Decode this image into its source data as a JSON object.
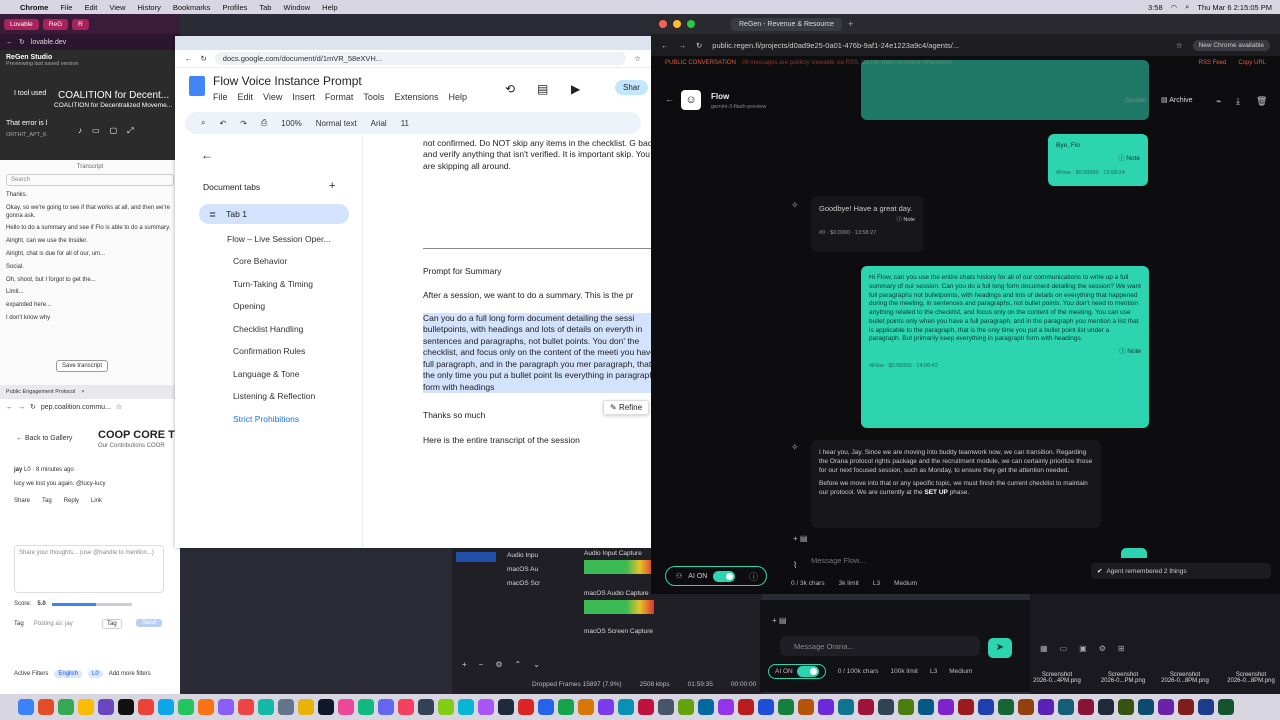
{
  "menubar": {
    "app": "Chrome",
    "items": [
      "File",
      "Edit",
      "View",
      "History",
      "Bookmarks",
      "Profiles",
      "Tab",
      "Window",
      "Help"
    ],
    "time": "3:58",
    "datetime": "Thu Mar 6 2:15:05 PM",
    "extra": "Gemini"
  },
  "left_browser": {
    "tab1": "Lovable",
    "tab2": "ReG",
    "tab3": "R",
    "url": "lovable.dev",
    "regen_title": "ReGen Studio",
    "regen_sub": "Previewing last saved version",
    "coalition1": "COALITION for Decent...",
    "coalition2": "COALITION for Decentralized Moveme...",
    "tool_used": "I tool used",
    "error_text": "That error is l",
    "error_sub": "ORTHIT_APT_K"
  },
  "transcript": {
    "header": "Transcript",
    "search_placeholder": "Search",
    "lines": [
      "Thanks.",
      "Okay, so we're going to see if that works at all, and then we're gonna ask.",
      "Hello to do a summary and see if Flo is able to do a summary.",
      "Alright, can we use the Insider.",
      "Alright, chat is due for all of our, um...",
      "Social.",
      "Oh, shoot, but I forgot to get the...",
      "Limit...",
      "expanded here...",
      "I don't know why"
    ],
    "save_button": "Save transcript"
  },
  "coop": {
    "tab": "Public Engagement Protocol",
    "url": "pep.coalition.commu...",
    "back": "Back to Gallery",
    "title": "COOP CORE T",
    "subtitle": "Our Contributions COOR",
    "author": "jay",
    "meta": "L0 · 8 minutes ago",
    "comment": "lucy we lost you again. @lucy-lucy",
    "actions": [
      "Share",
      "Tag",
      "Reply",
      "Link"
    ],
    "share_placeholder": "Share your thoughts... (use @handle to mention...)",
    "score_label": "Score:",
    "score_value": "5.0",
    "score_fraction": 0.55,
    "tag_label": "Tag",
    "posting_as": "Posting as: jay",
    "tag_button": "Tag",
    "send_button": "Send",
    "filters_label": "Active Filters",
    "filter1": "English",
    "filter2": "L0",
    "add_filters": "Add more filters"
  },
  "docs": {
    "url": "docs.google.com/document/d/1mVR_58eXVH...",
    "title": "Flow Voice Instance Prompt",
    "menus": [
      "File",
      "Edit",
      "View",
      "Insert",
      "Format",
      "Tools",
      "Extensions",
      "Help"
    ],
    "toolbar": {
      "zoom": "100%",
      "style": "Normal text",
      "font": "Arial",
      "size": "11"
    },
    "share": "Shar",
    "doc_tabs_label": "Document tabs",
    "tab1": "Tab 1",
    "outline": [
      "Flow – Live Session Oper...",
      "Core Behavior",
      "Turn-Taking & Timing",
      "Opening",
      "Checklist Handling",
      "Confirmation Rules",
      "Language & Tone",
      "Listening & Reflection",
      "Strict Prohibitions"
    ],
    "body_top": "not confirmed. Do NOT skip any items in the checklist. G back and verify anything that isn't verified. It is important skip. You are skipping all around.",
    "heading": "Prompt for Summary",
    "para1": "After a session, we want to do a summary. This is the pr",
    "para2": "Can you do a full long form document detailing the sessi bulletpoints, with headings and lots of details on everyth in sentences and paragraphs, not bullet points. You don' the checklist, and focus only on the content of the meeti you have a full paragraph, and in the paragraph you mer paragraph, that is the only time you put a bullet point lis everything in paragraph form with headings",
    "thanks": "Thanks so much",
    "transcript_line": "Here is the entire transcript of the session",
    "refine": "Refine"
  },
  "obs": {
    "rows": [
      "Audio Inpu",
      "macOS Au",
      "macOS Scr"
    ],
    "capture1": "Audio Input Capture",
    "capture2": "macOS Audio Capture",
    "capture3": "macOS Screen Capture",
    "dropped": "Dropped Frames 15897 (7.9%)",
    "kbps": "2508 kbps",
    "time1": "01:59:35",
    "time2": "00:00:00"
  },
  "regen": {
    "tab": "ReGen - Revenue & Resource",
    "url": "public.regen.fi/projects/d0ad9e25-0a01-476b-9af1-24e1223a9c4/agents/...",
    "new_chrome": "New Chrome available",
    "banner_tag": "PUBLIC CONVERSATION",
    "banner_warn": "All messages are publicly viewable via RSS. Do not share sensitive information.",
    "rss": "RSS Feed",
    "copy": "Copy URL",
    "agent_name": "Flow",
    "agent_model": "gemini-3-flash-preview",
    "session": "Session",
    "archive": "Archive",
    "msg1": "Bye, Flo",
    "msg1_meta": "#Flow · $0.00000 · 13:58:24",
    "reply1": "Goodbye! Have a great day.",
    "reply1_meta": "#0 · $0.0000 · 13:58:27",
    "msg2": "Hi Flow, can you use the entire chats history for all of our communications to write up a full summary of our session. Can you do a full long form document detailing the session? We want full paragraphs not bulletpoints, with headings and lots of details on everything that happened during the meeting, in sentences and paragraphs, not bullet points. You don't need to mention anything related to the checklist, and focus only on the content of the meeting. You can use bullet points only when you have a full paragraph, and in the paragraph you mention a list that is applicable to the paragraph, that is the only time you put a bullet point list under a paragraph. But primarily keep everything in paragraph form with headings.",
    "msg2_meta": "#Flow · $0.00000 · 14:00:42",
    "reply2a": "I hear you, Jay. Since we are moving into buddy teamwork now, we can transition. Regarding the Orana protocol rights package and the recruitment module, we can certainly prioritize those for our next focused session, such as Monday, to ensure they get the attention needed.",
    "reply2b_pre": "Before we move into that or any specific topic, we must finish the current checklist to maintain our protocol. We are currently at the",
    "reply2b_bold": "SET UP",
    "reply2b_post": "phase.",
    "note": "Note",
    "input_placeholder": "Message Flow...",
    "ai_label": "AI ON",
    "chars": "0 / 3k chars",
    "limit": "3k limit",
    "level": "L3",
    "medium": "Medium",
    "toast": "Agent remembered 2 things"
  },
  "regen2": {
    "placeholder": "Message Orana...",
    "ai_label": "AI ON",
    "chars": "0 / 100k chars",
    "limit": "100k limit",
    "level": "L3",
    "medium": "Medium"
  },
  "screenshots": [
    {
      "label": "Screenshot",
      "date": "2026-0...4PM.png"
    },
    {
      "label": "Screenshot",
      "date": "2026-0...PM.png"
    },
    {
      "label": "Screenshot",
      "date": "2026-0...8PM.png"
    },
    {
      "label": "Screenshot",
      "date": "2026-0...8PM.png"
    }
  ],
  "colors": {
    "accent": "#2dd4b0",
    "docs_blue": "#1a73e8",
    "banner": "#e25a3b"
  }
}
